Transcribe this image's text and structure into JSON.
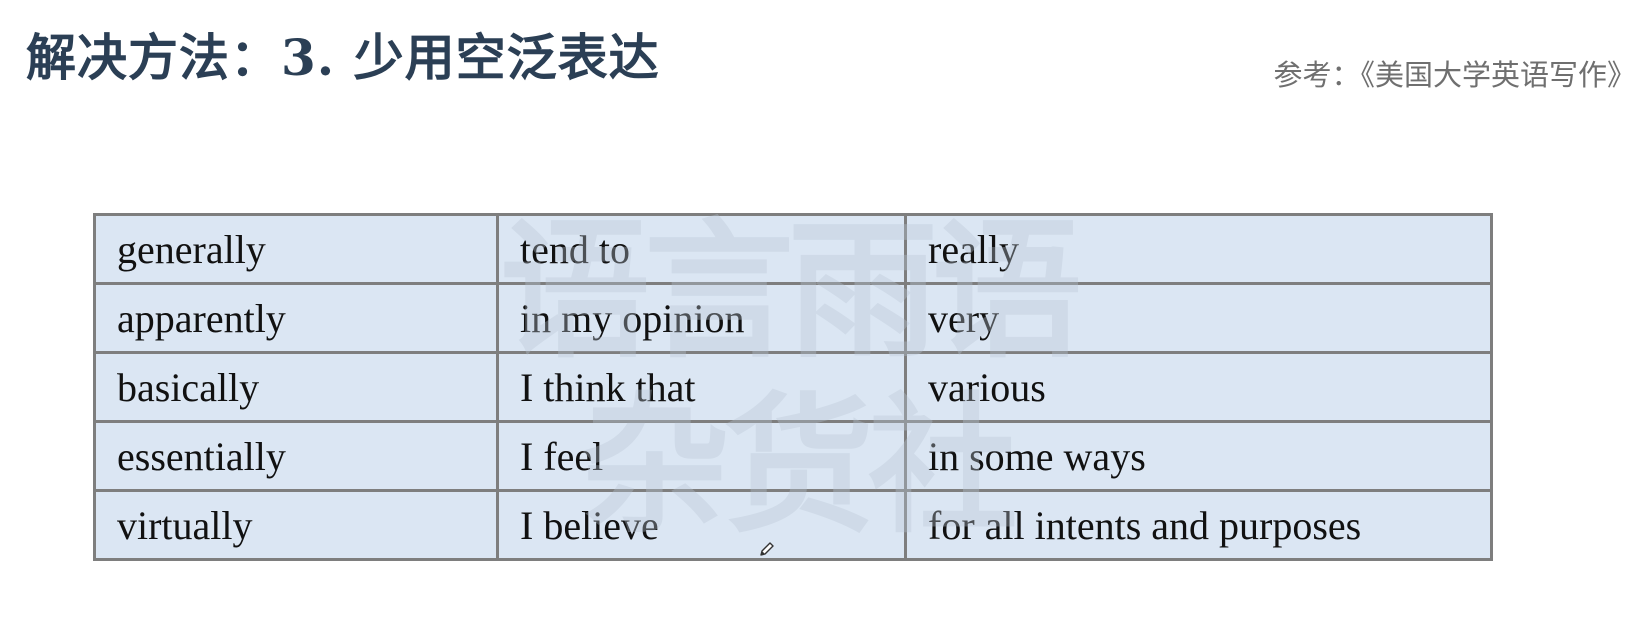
{
  "slide": {
    "title": "解决方法：3. 少用空泛表达",
    "reference": "参考：《美国大学英语写作》"
  },
  "watermark": {
    "line1": "语言雨语",
    "line2": "杂货社"
  },
  "table": {
    "rows": [
      [
        "generally",
        "tend to",
        "really"
      ],
      [
        "apparently",
        "in my opinion",
        "very"
      ],
      [
        "basically",
        "I think that",
        "various"
      ],
      [
        "essentially",
        "I feel",
        "in some ways"
      ],
      [
        "virtually",
        "I believe",
        "for all intents and purposes"
      ]
    ]
  },
  "cursor": {
    "icon": "pencil-icon"
  }
}
